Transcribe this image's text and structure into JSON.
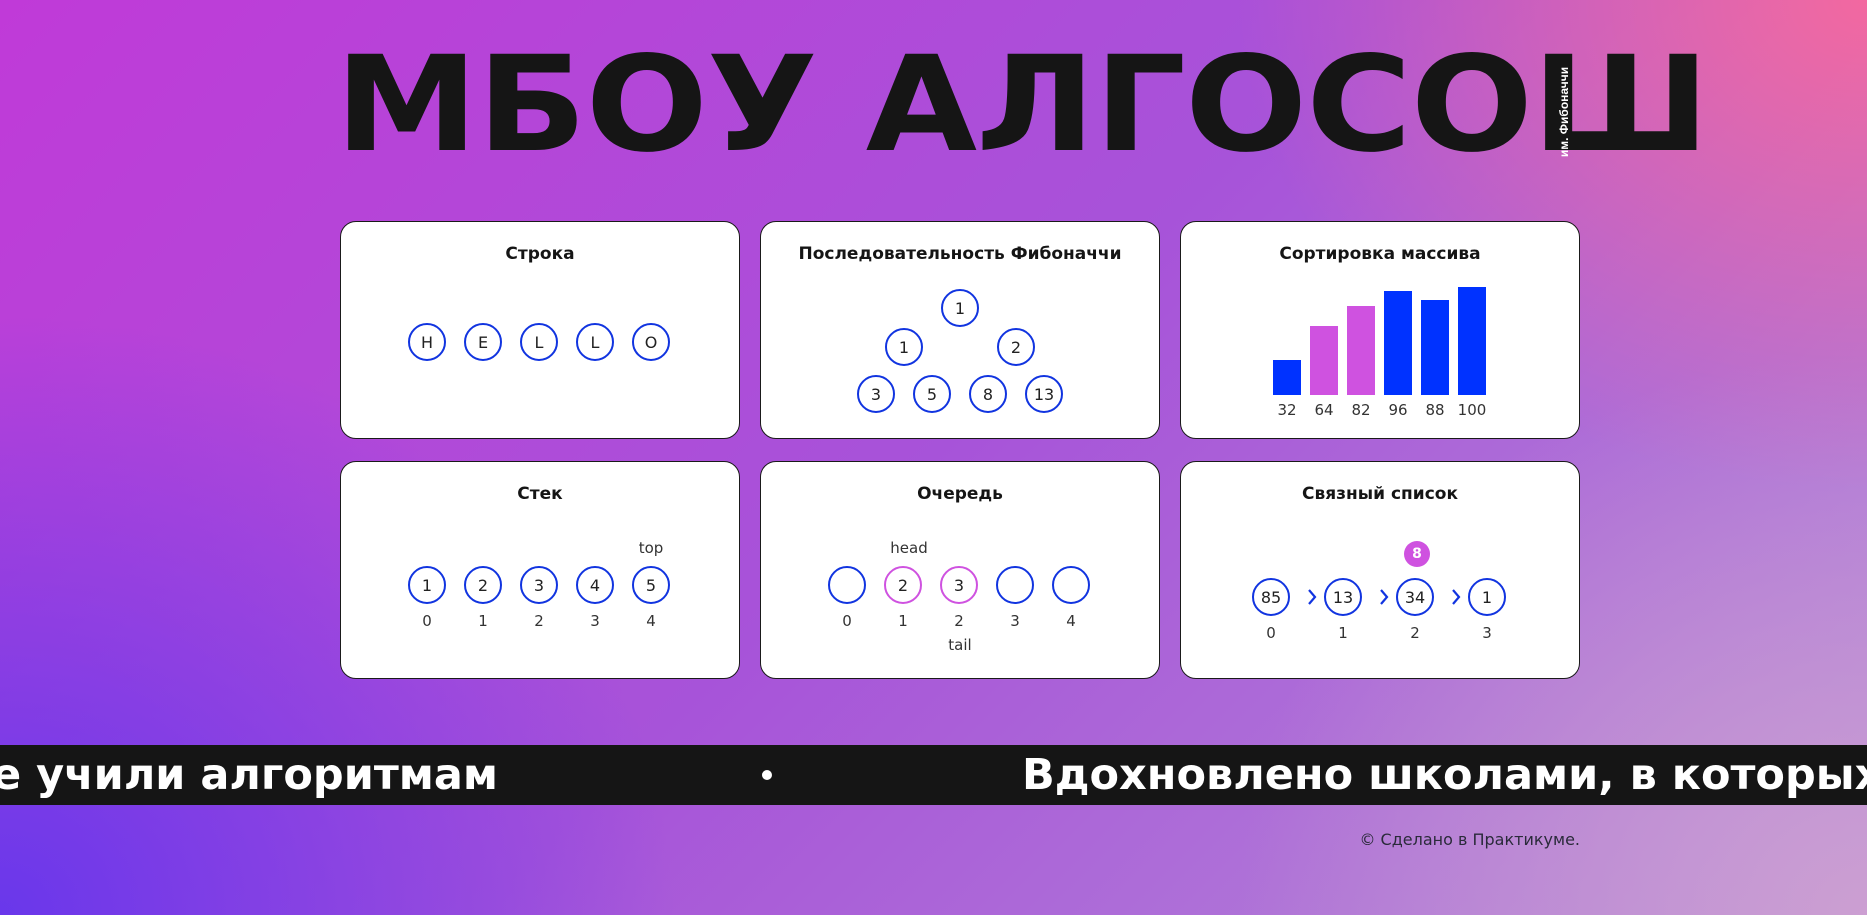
{
  "header": {
    "title": "МБОУ АЛГОСОШ",
    "subtitle": "им. Фибоначчи"
  },
  "cards": {
    "string": {
      "title": "Строка",
      "letters": [
        "H",
        "E",
        "L",
        "L",
        "O"
      ]
    },
    "fibonacci": {
      "title": "Последовательность Фибоначчи",
      "values": [
        "1",
        "1",
        "2",
        "3",
        "5",
        "8",
        "13"
      ]
    },
    "sorting": {
      "title": "Сортировка массива",
      "colors": {
        "default": "#0032ff",
        "changing": "#cf52e0"
      },
      "bars": [
        {
          "value": "32",
          "state": "default"
        },
        {
          "value": "64",
          "state": "changing"
        },
        {
          "value": "82",
          "state": "changing"
        },
        {
          "value": "96",
          "state": "default"
        },
        {
          "value": "88",
          "state": "default"
        },
        {
          "value": "100",
          "state": "default"
        }
      ]
    },
    "stack": {
      "title": "Стек",
      "top_label": "top",
      "items": [
        {
          "value": "1",
          "index": "0"
        },
        {
          "value": "2",
          "index": "1"
        },
        {
          "value": "3",
          "index": "2"
        },
        {
          "value": "4",
          "index": "3"
        },
        {
          "value": "5",
          "index": "4"
        }
      ]
    },
    "queue": {
      "title": "Очередь",
      "head_label": "head",
      "tail_label": "tail",
      "items": [
        {
          "value": "",
          "index": "0",
          "state": "default"
        },
        {
          "value": "2",
          "index": "1",
          "state": "changing"
        },
        {
          "value": "3",
          "index": "2",
          "state": "changing"
        },
        {
          "value": "",
          "index": "3",
          "state": "default"
        },
        {
          "value": "",
          "index": "4",
          "state": "default"
        }
      ]
    },
    "linked_list": {
      "title": "Связный список",
      "insert_value": "8",
      "arrow_icon": "chevron-right-icon",
      "items": [
        {
          "value": "85",
          "index": "0"
        },
        {
          "value": "13",
          "index": "1"
        },
        {
          "value": "34",
          "index": "2"
        },
        {
          "value": "1",
          "index": "3"
        }
      ]
    }
  },
  "marquee": {
    "part_left": "е учили алгоритмам",
    "part_right": "Вдохновлено школами, в которых"
  },
  "footer": {
    "copyright": "© Сделано в Практикуме."
  }
}
